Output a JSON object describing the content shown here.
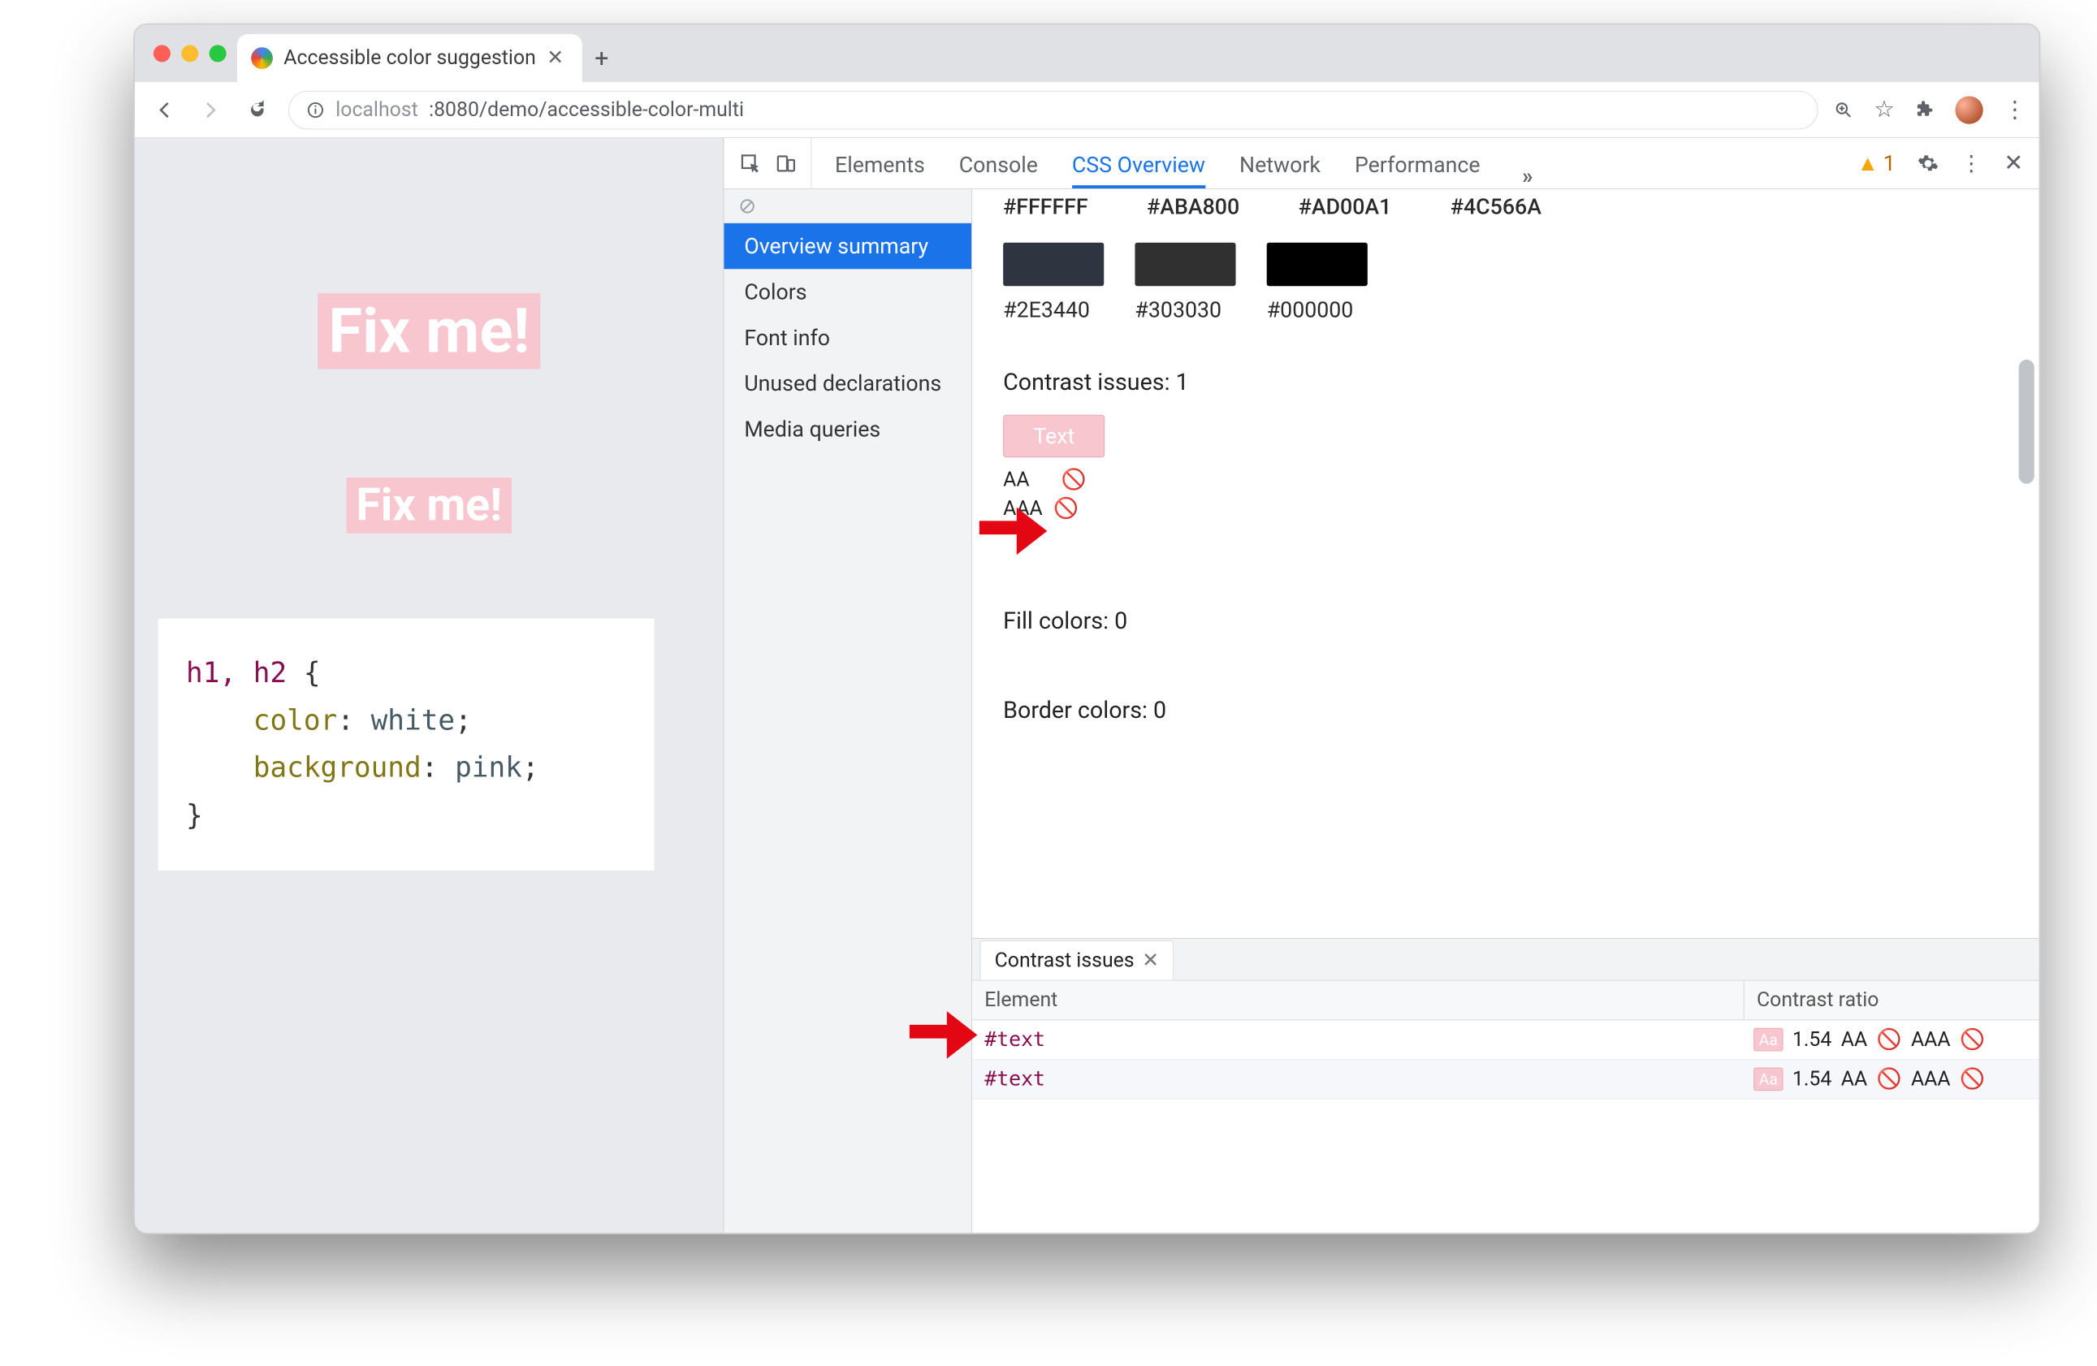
{
  "window": {
    "tab_title": "Accessible color suggestion"
  },
  "toolbar": {
    "url_host_prefix": "localhost",
    "url_host_suffix": ":8080/demo/accessible-color-multi"
  },
  "page": {
    "h1": "Fix me!",
    "h2": "Fix me!",
    "code": {
      "selector": "h1, h2",
      "prop1": "color",
      "val1": "white",
      "prop2": "background",
      "val2": "pink"
    }
  },
  "devtools": {
    "tabs": {
      "elements": "Elements",
      "console": "Console",
      "css_overview": "CSS Overview",
      "network": "Network",
      "performance": "Performance"
    },
    "warning_count": "1"
  },
  "sidebar": {
    "items": [
      "Overview summary",
      "Colors",
      "Font info",
      "Unused declarations",
      "Media queries"
    ]
  },
  "colors": {
    "toprow": [
      "#FFFFFF",
      "#ABA800",
      "#AD00A1",
      "#4C566A"
    ],
    "swatches": [
      {
        "hex": "#2E3440",
        "fill": "#2E3440"
      },
      {
        "hex": "#303030",
        "fill": "#303030"
      },
      {
        "hex": "#000000",
        "fill": "#000000"
      }
    ]
  },
  "overview": {
    "contrast_heading": "Contrast issues: 1",
    "chip_text": "Text",
    "aa_label": "AA",
    "aaa_label": "AAA",
    "fill_heading": "Fill colors: 0",
    "border_heading": "Border colors: 0"
  },
  "issues": {
    "tab_label": "Contrast issues",
    "col_element": "Element",
    "col_ratio": "Contrast ratio",
    "rows": [
      {
        "el": "#text",
        "ratio": "1.54",
        "aa": "AA",
        "aaa": "AAA",
        "swatch": "Aa"
      },
      {
        "el": "#text",
        "ratio": "1.54",
        "aa": "AA",
        "aaa": "AAA",
        "swatch": "Aa"
      }
    ]
  }
}
